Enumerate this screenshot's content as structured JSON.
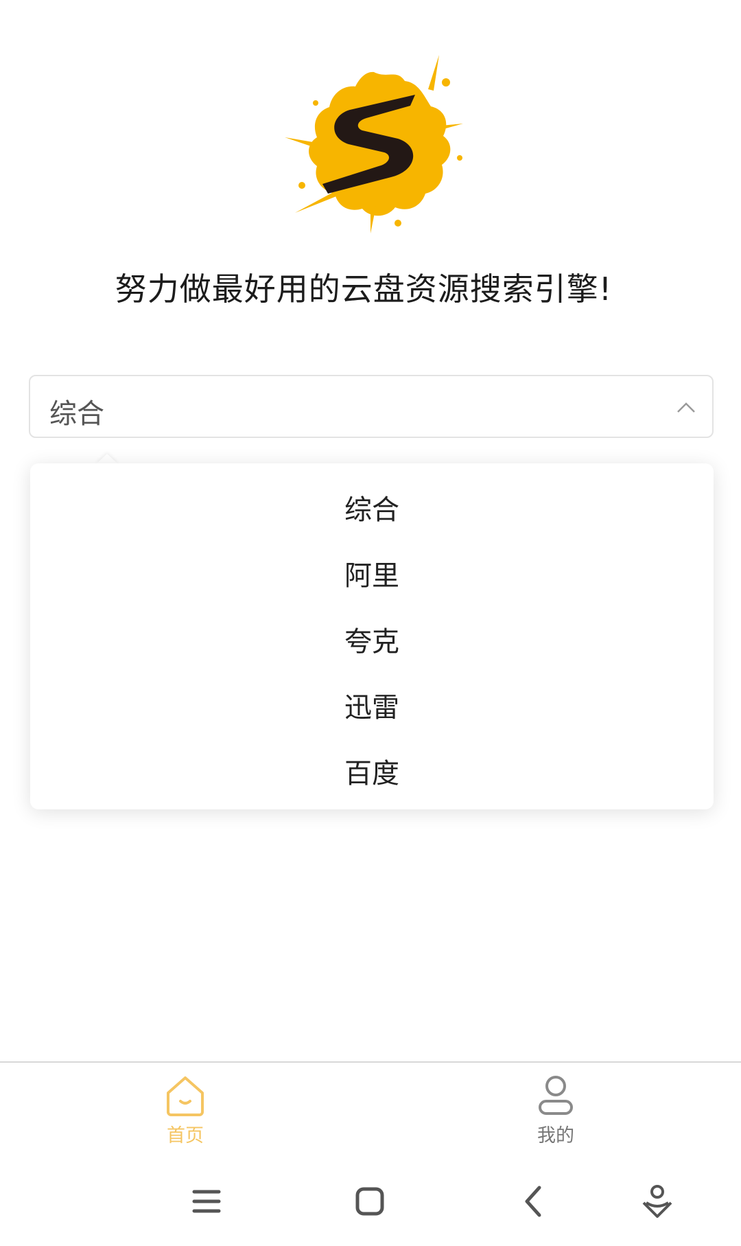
{
  "tagline": "努力做最好用的云盘资源搜索引擎!",
  "search_type_select": {
    "value": "综合",
    "options": [
      "综合",
      "阿里",
      "夸克",
      "迅雷",
      "百度"
    ]
  },
  "tabbar": {
    "home_label": "首页",
    "mine_label": "我的"
  },
  "colors": {
    "brand_yellow": "#f7b500",
    "active_tab": "#f5c562",
    "inactive_tab": "#777777"
  },
  "icons": {
    "logo": "splash-s-logo",
    "home": "home-icon",
    "mine": "user-icon",
    "arrow": "chevron-up-icon",
    "system": [
      "menu-icon",
      "home-square-icon",
      "back-icon",
      "assistant-icon"
    ]
  }
}
